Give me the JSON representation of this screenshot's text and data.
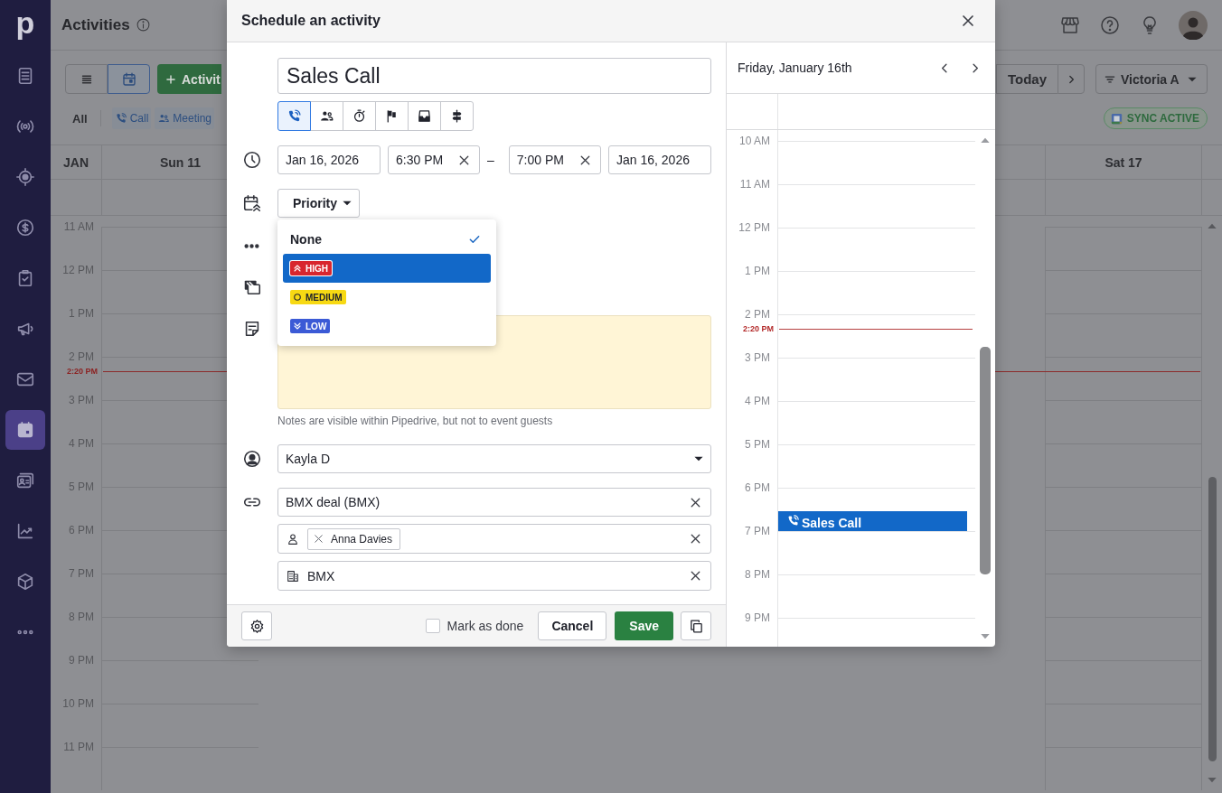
{
  "sidebar": {
    "logo": "p",
    "items": [
      {
        "kind": "doc",
        "selected": false
      },
      {
        "kind": "broadcast",
        "selected": false
      },
      {
        "kind": "target",
        "selected": false
      },
      {
        "kind": "dollar",
        "selected": false
      },
      {
        "kind": "clipboard",
        "selected": false
      },
      {
        "kind": "megaphone",
        "selected": false
      },
      {
        "kind": "mail",
        "selected": false
      },
      {
        "kind": "calendar",
        "selected": true
      },
      {
        "kind": "contacts",
        "selected": false
      },
      {
        "kind": "chart",
        "selected": false
      },
      {
        "kind": "box",
        "selected": false
      },
      {
        "kind": "more",
        "selected": false
      }
    ]
  },
  "header": {
    "title": "Activities"
  },
  "toolbar": {
    "views": [
      {
        "kind": "list",
        "selected": false
      },
      {
        "kind": "calendar",
        "selected": true
      }
    ],
    "add_button": "Activit",
    "today_button": "Today",
    "filter_button": "Victoria A"
  },
  "filters": {
    "all": "All",
    "types": [
      {
        "kind": "call",
        "label": "Call"
      },
      {
        "kind": "meeting",
        "label": "Meeting"
      }
    ],
    "sync_badge": "SYNC ACTIVE"
  },
  "calendar": {
    "month": "JAN",
    "days": [
      "Sun 11",
      "Sat 17"
    ],
    "hours": [
      "11 AM",
      "12 PM",
      "1 PM",
      "2 PM",
      "3 PM",
      "4 PM",
      "5 PM",
      "6 PM",
      "7 PM",
      "8 PM",
      "9 PM",
      "10 PM",
      "11 PM"
    ],
    "now_label": "2:20 PM"
  },
  "modal": {
    "title": "Schedule an activity",
    "subject": "Sales Call",
    "types": [
      {
        "kind": "call",
        "selected": true
      },
      {
        "kind": "meeting",
        "selected": false
      },
      {
        "kind": "timer",
        "selected": false
      },
      {
        "kind": "flag",
        "selected": false
      },
      {
        "kind": "tray",
        "selected": false
      },
      {
        "kind": "signpost",
        "selected": false
      }
    ],
    "start_date": "Jan 16, 2026",
    "start_time": "6:30 PM",
    "separator": "–",
    "end_time": "7:00 PM",
    "end_date": "Jan 16, 2026",
    "priority_button": "Priority",
    "priority_menu": [
      {
        "kind": "none",
        "label": "None",
        "selected": true,
        "highlighted": false
      },
      {
        "kind": "high",
        "label": "HIGH",
        "selected": false,
        "highlighted": true
      },
      {
        "kind": "medium",
        "label": "MEDIUM",
        "selected": false,
        "highlighted": false
      },
      {
        "kind": "low",
        "label": "LOW",
        "selected": false,
        "highlighted": false
      }
    ],
    "notes_hint": "Notes are visible within Pipedrive, but not to event guests",
    "owner": "Kayla D",
    "deal": "BMX deal (BMX)",
    "people": [
      "Anna Davies"
    ],
    "organization": "BMX",
    "mark_done": {
      "label": "Mark as done",
      "checked": false
    },
    "cancel_button": "Cancel",
    "save_button": "Save"
  },
  "day_panel": {
    "title": "Friday, January 16th",
    "hours": [
      "10 AM",
      "11 AM",
      "12 PM",
      "1 PM",
      "2 PM",
      "3 PM",
      "4 PM",
      "5 PM",
      "6 PM",
      "7 PM",
      "8 PM",
      "9 PM"
    ],
    "now_label": "2:20 PM",
    "events": [
      {
        "kind": "call",
        "title": "Sales Call"
      }
    ]
  }
}
